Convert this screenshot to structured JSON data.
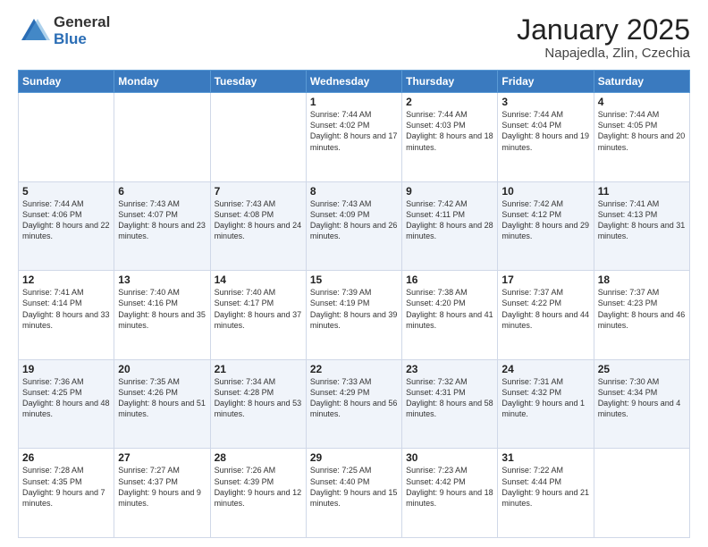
{
  "logo": {
    "general": "General",
    "blue": "Blue"
  },
  "title": "January 2025",
  "subtitle": "Napajedla, Zlin, Czechia",
  "weekdays": [
    "Sunday",
    "Monday",
    "Tuesday",
    "Wednesday",
    "Thursday",
    "Friday",
    "Saturday"
  ],
  "weeks": [
    [
      {
        "day": "",
        "info": ""
      },
      {
        "day": "",
        "info": ""
      },
      {
        "day": "",
        "info": ""
      },
      {
        "day": "1",
        "info": "Sunrise: 7:44 AM\nSunset: 4:02 PM\nDaylight: 8 hours\nand 17 minutes."
      },
      {
        "day": "2",
        "info": "Sunrise: 7:44 AM\nSunset: 4:03 PM\nDaylight: 8 hours\nand 18 minutes."
      },
      {
        "day": "3",
        "info": "Sunrise: 7:44 AM\nSunset: 4:04 PM\nDaylight: 8 hours\nand 19 minutes."
      },
      {
        "day": "4",
        "info": "Sunrise: 7:44 AM\nSunset: 4:05 PM\nDaylight: 8 hours\nand 20 minutes."
      }
    ],
    [
      {
        "day": "5",
        "info": "Sunrise: 7:44 AM\nSunset: 4:06 PM\nDaylight: 8 hours\nand 22 minutes."
      },
      {
        "day": "6",
        "info": "Sunrise: 7:43 AM\nSunset: 4:07 PM\nDaylight: 8 hours\nand 23 minutes."
      },
      {
        "day": "7",
        "info": "Sunrise: 7:43 AM\nSunset: 4:08 PM\nDaylight: 8 hours\nand 24 minutes."
      },
      {
        "day": "8",
        "info": "Sunrise: 7:43 AM\nSunset: 4:09 PM\nDaylight: 8 hours\nand 26 minutes."
      },
      {
        "day": "9",
        "info": "Sunrise: 7:42 AM\nSunset: 4:11 PM\nDaylight: 8 hours\nand 28 minutes."
      },
      {
        "day": "10",
        "info": "Sunrise: 7:42 AM\nSunset: 4:12 PM\nDaylight: 8 hours\nand 29 minutes."
      },
      {
        "day": "11",
        "info": "Sunrise: 7:41 AM\nSunset: 4:13 PM\nDaylight: 8 hours\nand 31 minutes."
      }
    ],
    [
      {
        "day": "12",
        "info": "Sunrise: 7:41 AM\nSunset: 4:14 PM\nDaylight: 8 hours\nand 33 minutes."
      },
      {
        "day": "13",
        "info": "Sunrise: 7:40 AM\nSunset: 4:16 PM\nDaylight: 8 hours\nand 35 minutes."
      },
      {
        "day": "14",
        "info": "Sunrise: 7:40 AM\nSunset: 4:17 PM\nDaylight: 8 hours\nand 37 minutes."
      },
      {
        "day": "15",
        "info": "Sunrise: 7:39 AM\nSunset: 4:19 PM\nDaylight: 8 hours\nand 39 minutes."
      },
      {
        "day": "16",
        "info": "Sunrise: 7:38 AM\nSunset: 4:20 PM\nDaylight: 8 hours\nand 41 minutes."
      },
      {
        "day": "17",
        "info": "Sunrise: 7:37 AM\nSunset: 4:22 PM\nDaylight: 8 hours\nand 44 minutes."
      },
      {
        "day": "18",
        "info": "Sunrise: 7:37 AM\nSunset: 4:23 PM\nDaylight: 8 hours\nand 46 minutes."
      }
    ],
    [
      {
        "day": "19",
        "info": "Sunrise: 7:36 AM\nSunset: 4:25 PM\nDaylight: 8 hours\nand 48 minutes."
      },
      {
        "day": "20",
        "info": "Sunrise: 7:35 AM\nSunset: 4:26 PM\nDaylight: 8 hours\nand 51 minutes."
      },
      {
        "day": "21",
        "info": "Sunrise: 7:34 AM\nSunset: 4:28 PM\nDaylight: 8 hours\nand 53 minutes."
      },
      {
        "day": "22",
        "info": "Sunrise: 7:33 AM\nSunset: 4:29 PM\nDaylight: 8 hours\nand 56 minutes."
      },
      {
        "day": "23",
        "info": "Sunrise: 7:32 AM\nSunset: 4:31 PM\nDaylight: 8 hours\nand 58 minutes."
      },
      {
        "day": "24",
        "info": "Sunrise: 7:31 AM\nSunset: 4:32 PM\nDaylight: 9 hours\nand 1 minute."
      },
      {
        "day": "25",
        "info": "Sunrise: 7:30 AM\nSunset: 4:34 PM\nDaylight: 9 hours\nand 4 minutes."
      }
    ],
    [
      {
        "day": "26",
        "info": "Sunrise: 7:28 AM\nSunset: 4:35 PM\nDaylight: 9 hours\nand 7 minutes."
      },
      {
        "day": "27",
        "info": "Sunrise: 7:27 AM\nSunset: 4:37 PM\nDaylight: 9 hours\nand 9 minutes."
      },
      {
        "day": "28",
        "info": "Sunrise: 7:26 AM\nSunset: 4:39 PM\nDaylight: 9 hours\nand 12 minutes."
      },
      {
        "day": "29",
        "info": "Sunrise: 7:25 AM\nSunset: 4:40 PM\nDaylight: 9 hours\nand 15 minutes."
      },
      {
        "day": "30",
        "info": "Sunrise: 7:23 AM\nSunset: 4:42 PM\nDaylight: 9 hours\nand 18 minutes."
      },
      {
        "day": "31",
        "info": "Sunrise: 7:22 AM\nSunset: 4:44 PM\nDaylight: 9 hours\nand 21 minutes."
      },
      {
        "day": "",
        "info": ""
      }
    ]
  ]
}
